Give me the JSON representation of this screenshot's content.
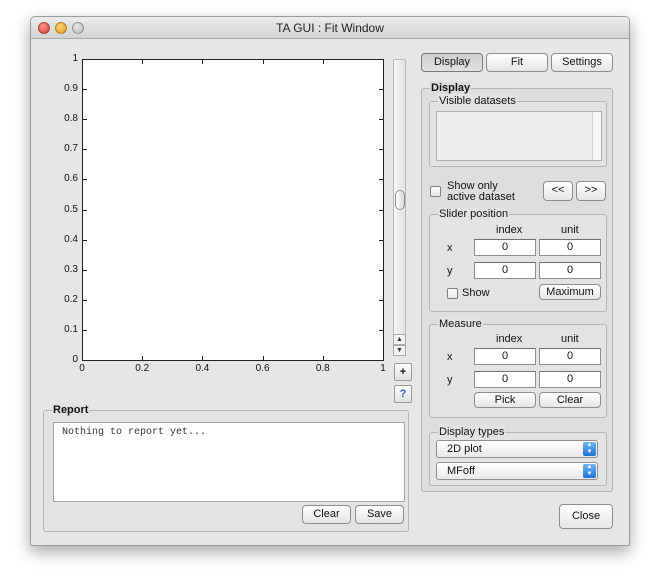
{
  "window": {
    "title": "TA GUI : Fit Window"
  },
  "plot": {
    "y_ticks": [
      "1",
      "0.9",
      "0.8",
      "0.7",
      "0.6",
      "0.5",
      "0.4",
      "0.3",
      "0.2",
      "0.1",
      "0"
    ],
    "x_ticks": [
      "0",
      "0.2",
      "0.4",
      "0.6",
      "0.8",
      "1"
    ]
  },
  "side_buttons": {
    "plus": "+",
    "help": "?"
  },
  "report": {
    "title": "Report",
    "text": "Nothing to report yet...",
    "clear_label": "Clear",
    "save_label": "Save"
  },
  "tabs": [
    {
      "label": "Display",
      "active": true
    },
    {
      "label": "Fit",
      "active": false
    },
    {
      "label": "Settings",
      "active": false
    }
  ],
  "display_panel": {
    "title": "Display",
    "visible_datasets": {
      "title": "Visible datasets",
      "items": []
    },
    "show_only_active": {
      "label_line1": "Show only",
      "label_line2": "active dataset",
      "checked": false
    },
    "prev_label": "<<",
    "next_label": ">>",
    "slider_position": {
      "title": "Slider position",
      "col_index": "index",
      "col_unit": "unit",
      "x_label": "x",
      "y_label": "y",
      "x_index": "0",
      "x_unit": "0",
      "y_index": "0",
      "y_unit": "0",
      "show_label": "Show",
      "show_checked": false,
      "maximum_label": "Maximum"
    },
    "measure": {
      "title": "Measure",
      "col_index": "index",
      "col_unit": "unit",
      "x_label": "x",
      "y_label": "y",
      "x_index": "0",
      "x_unit": "0",
      "y_index": "0",
      "y_unit": "0",
      "pick_label": "Pick",
      "clear_label": "Clear"
    },
    "display_types": {
      "title": "Display types",
      "plot_type": "2D plot",
      "mode": "MFoff"
    }
  },
  "close_label": "Close",
  "colors": {
    "window_bg": "#e6e6e6",
    "popup_accent": "#1f73d6"
  }
}
